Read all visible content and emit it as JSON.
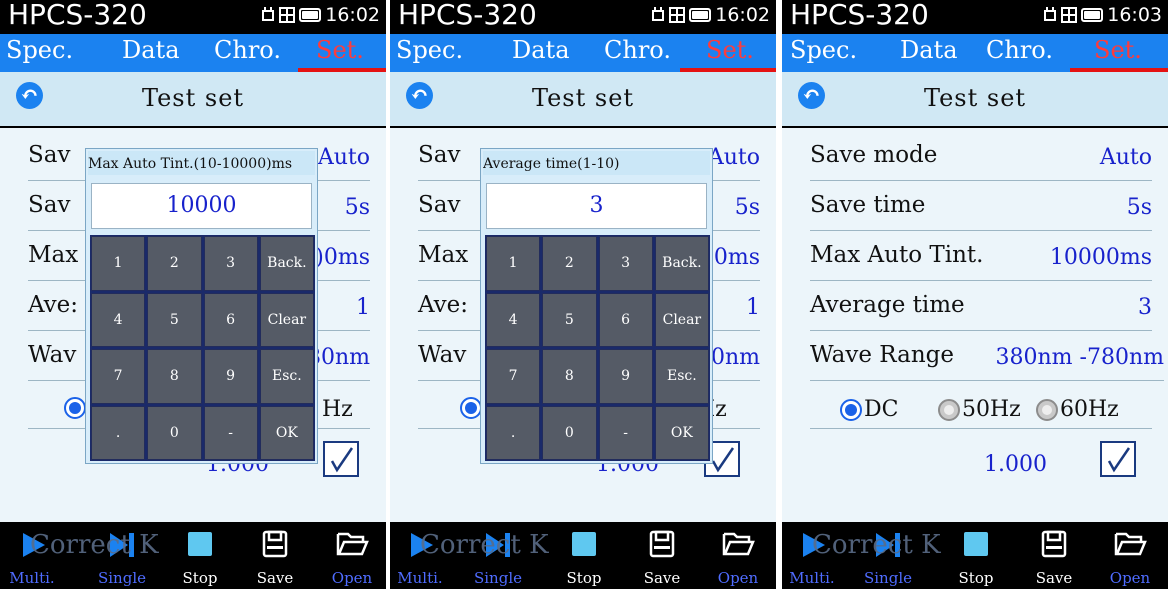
{
  "status": {
    "model": "HPCS-320"
  },
  "tabs": [
    "Spec.",
    "Data",
    "Chro.",
    "Set."
  ],
  "page_title": "Test set",
  "settings": {
    "save_mode_label": "Save mode",
    "save_mode_value": "Auto",
    "save_time_label": "Save time",
    "save_time_value": "5s",
    "max_tint_label": "Max Auto Tint.",
    "max_tint_value": "10000ms",
    "avg_time_label": "Average time",
    "avg_time_value": "3",
    "wave_label": "Wave Range",
    "wave_value": "380nm -780nm",
    "wave_value_partial": "80nm"
  },
  "power": {
    "dc": "DC",
    "hz50": "50Hz",
    "hz60": "60Hz",
    "selected": "DC"
  },
  "correction": {
    "label": "Correct K",
    "value": "1.000",
    "checked": true
  },
  "toolbar": {
    "multi": "Multi.",
    "single": "Single",
    "stop": "Stop",
    "save": "Save",
    "open": "Open"
  },
  "screens": [
    {
      "time": "16:02",
      "partial": {
        "save_mode": "Sav",
        "save_time": "Sav",
        "max_tint": "Max",
        "avg_time": "Ave:",
        "wave": "Wav",
        "save_mode_val": "Auto",
        "save_time_val": "5s",
        "max_tint_val": ")0ms",
        "avg_time_val": "1",
        "wave_val": "80nm",
        "hz_val": "Hz"
      },
      "dialog": {
        "title": "Max Auto Tint.(10-10000)ms",
        "value": "10000"
      }
    },
    {
      "time": "16:02",
      "partial": {
        "save_mode": "Sav",
        "save_time": "Sav",
        "max_tint": "Max",
        "avg_time": "Ave:",
        "wave": "Wav",
        "save_mode_val": "Auto",
        "save_time_val": "5s",
        "max_tint_val": ")0ms",
        "avg_time_val": "1",
        "wave_val": "80nm",
        "hz_val": "Hz"
      },
      "dialog": {
        "title": "Average time(1-10)",
        "value": "3"
      }
    },
    {
      "time": "16:03"
    }
  ],
  "keypad": [
    "1",
    "2",
    "3",
    "Back.",
    "4",
    "5",
    "6",
    "Clear",
    "7",
    "8",
    "9",
    "Esc.",
    ".",
    "0",
    "-",
    "OK"
  ],
  "colors": {
    "accent": "#1b82f0",
    "active_tab": "#ff3b3b",
    "value": "#1822cc",
    "key": "#555b66"
  }
}
